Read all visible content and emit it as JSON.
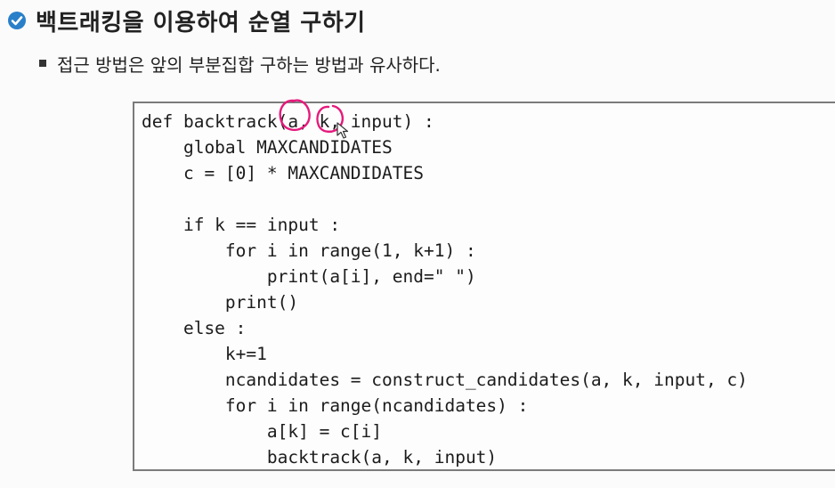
{
  "slide": {
    "title": "백트래킹을 이용하여 순열 구하기",
    "bullet": "접근 방법은 앞의 부분집합 구하는 방법과 유사하다."
  },
  "code": {
    "lines": [
      "def backtrack(a, k, input) :",
      "    global MAXCANDIDATES",
      "    c = [0] * MAXCANDIDATES",
      "",
      "    if k == input :",
      "        for i in range(1, k+1) :",
      "            print(a[i], end=\" \")",
      "        print()",
      "    else :",
      "        k+=1",
      "        ncandidates = construct_candidates(a, k, input, c)",
      "        for i in range(ncandidates) :",
      "            a[k] = c[i]",
      "            backtrack(a, k, input)"
    ]
  },
  "colors": {
    "check_icon": "#2a7fc9",
    "annotation": "#e6197c",
    "code_border": "#7b7b7b"
  },
  "icons": {
    "title_marker": "check-circle-icon",
    "pointer": "pen-cursor-icon"
  }
}
